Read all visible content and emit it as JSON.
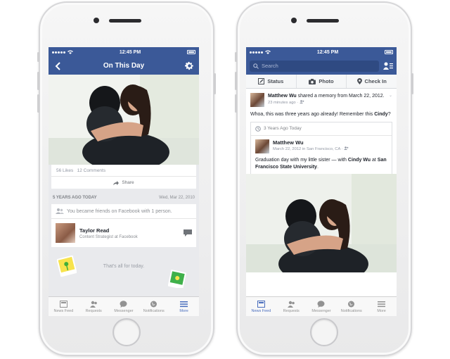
{
  "status": {
    "time": "12:45 PM"
  },
  "left": {
    "nav_title": "On This Day",
    "likes": "56 Likes",
    "comments": "12 Comments",
    "share_label": "Share",
    "section_title": "5 YEARS AGO TODAY",
    "section_date": "Wed, Mar 22, 2010",
    "friends_line": "You became friends on Facebook with 1 person.",
    "friend_name": "Taylor Read",
    "friend_subtitle": "Content Strategist at Facebook",
    "end_text": "That's all for today."
  },
  "right": {
    "search_placeholder": "Search",
    "composer": {
      "status": "Status",
      "photo": "Photo",
      "checkin": "Check In"
    },
    "post": {
      "author": "Matthew Wu",
      "action": " shared a memory from March 22, 2012.",
      "time": "23 minutes ago · ",
      "text_before": "Whoa, this was three years ago already! Remember this ",
      "text_tag": "Cindy",
      "text_after": "?"
    },
    "memory": {
      "header": "3 Years Ago Today",
      "author": "Matthew Wu",
      "date": "March 22, 2012 in San Francisco, CA · ",
      "text_before": "Graduation day with my little sister — with ",
      "tag_person": "Cindy Wu",
      "text_mid": " at ",
      "tag_place": "San Francisco State University",
      "text_after": "."
    }
  },
  "tabs": [
    {
      "label": "News Feed",
      "icon": "news-feed-icon"
    },
    {
      "label": "Requests",
      "icon": "friend-requests-icon"
    },
    {
      "label": "Messenger",
      "icon": "messenger-icon"
    },
    {
      "label": "Notifications",
      "icon": "globe-icon"
    },
    {
      "label": "More",
      "icon": "menu-icon"
    }
  ],
  "colors": {
    "brand_blue": "#3b5998",
    "active_tab": "#4a6ebd",
    "feed_bg": "#e9eaed"
  }
}
